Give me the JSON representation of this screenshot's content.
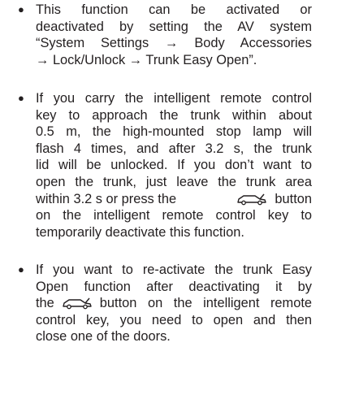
{
  "bullets": [
    {
      "lines": [
        "This function can be activated or",
        "deactivated by setting the AV system",
        "“System Settings → Body Accessories",
        "→ Lock/Unlock → Trunk Easy Open”."
      ]
    },
    {
      "lines": [
        "If you carry the intelligent remote control",
        "key to approach the trunk within about",
        "0.5 m, the high-mounted stop lamp will",
        "flash 4 times, and after 3.2 s, the trunk",
        "lid will be unlocked. If you don’t want to",
        "open the trunk, just leave the trunk area"
      ],
      "icon_line_before": "within 3.2 s or press the",
      "icon_line_after": "button",
      "tail_lines": [
        "on the intelligent remote control key to",
        "temporarily deactivate this function."
      ]
    },
    {
      "lines": [
        "If you want to re-activate the trunk Easy",
        "Open function after deactivating it by"
      ],
      "icon_line_before": "the",
      "icon_line_after": "button on the intelligent remote",
      "tail_lines": [
        "control key, you need to open and then",
        "close one of the doors."
      ]
    }
  ],
  "icons": {
    "trunk_button": "car-trunk-icon"
  }
}
